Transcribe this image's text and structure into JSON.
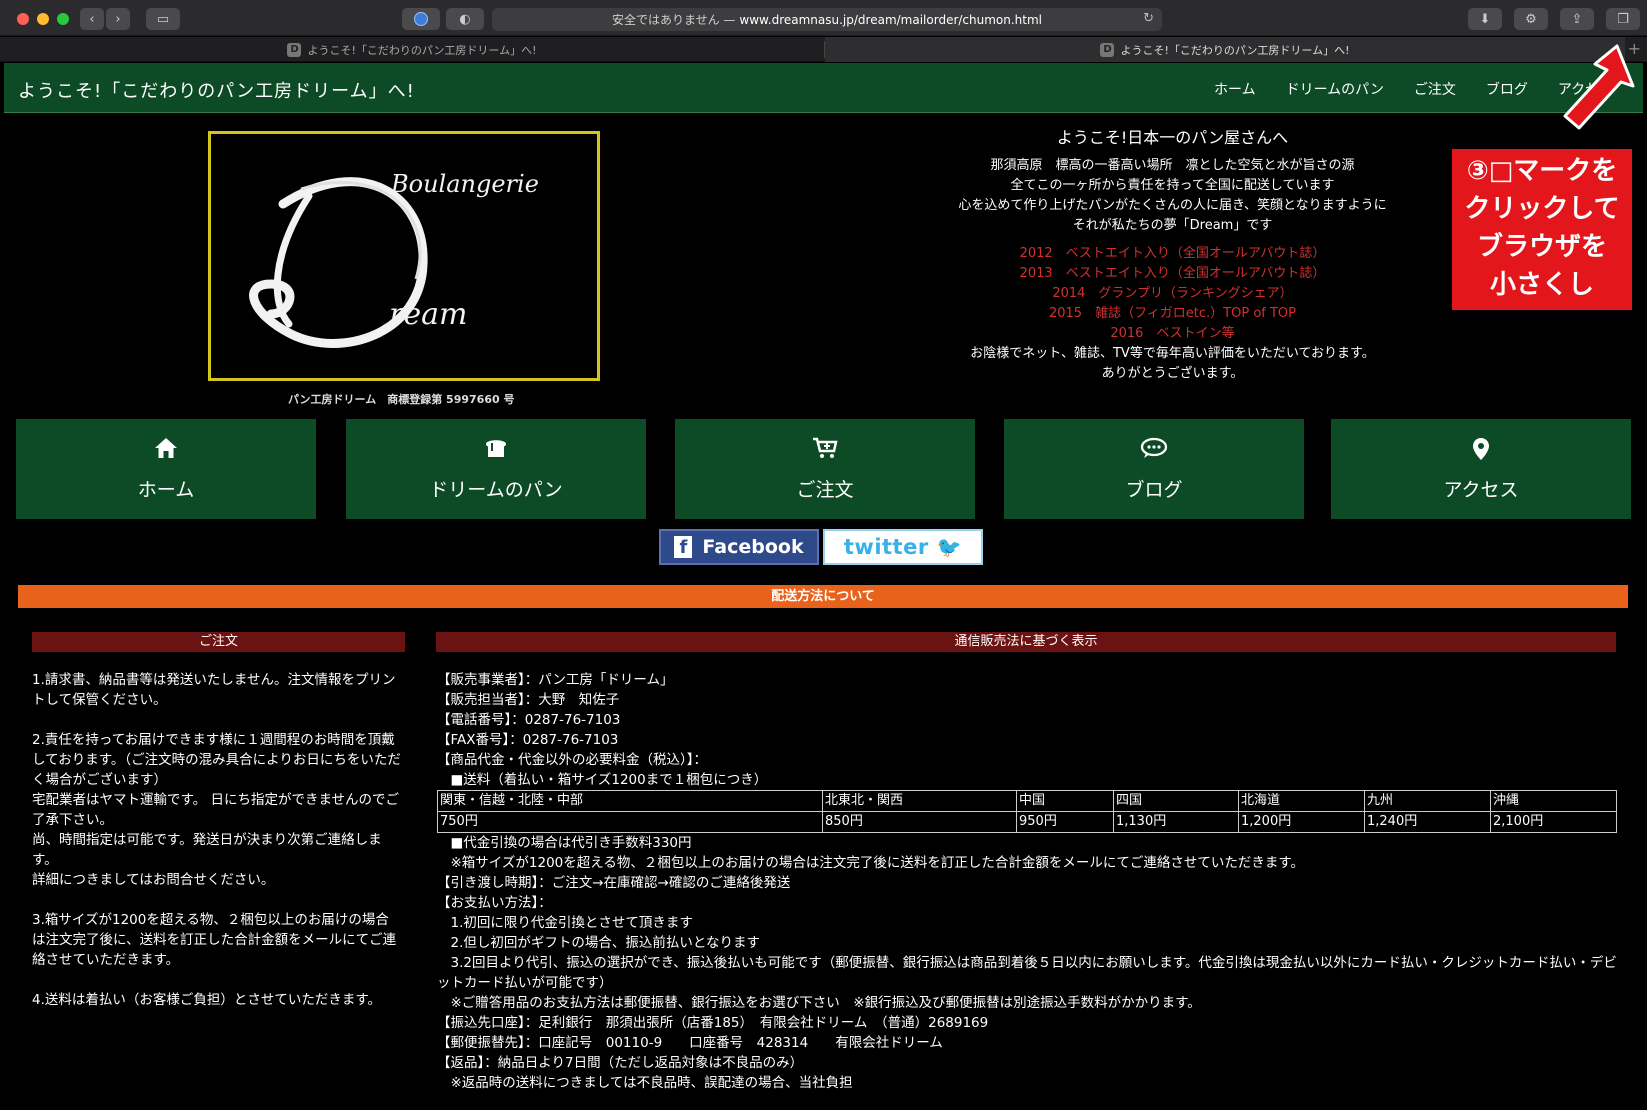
{
  "browser": {
    "url_prefix": "安全ではありません —",
    "url_host": "www.dreamnasu.jp/dream/mailorder/chumon.html",
    "tabs": [
      {
        "favicon": "D",
        "title": "ようこそ!「こだわりのパン工房ドリーム」へ!"
      },
      {
        "favicon": "D",
        "title": "ようこそ!「こだわりのパン工房ドリーム」へ!"
      }
    ]
  },
  "header": {
    "title": "ようこそ!「こだわりのパン工房ドリーム」へ!",
    "nav": [
      "ホーム",
      "ドリームのパン",
      "ご注文",
      "ブログ",
      "アクセス"
    ]
  },
  "logo": {
    "line1": "Boulangerie",
    "line2": "ream",
    "caption": "パン工房ドリーム　商標登録第 5997660 号"
  },
  "welcome": {
    "heading": "ようこそ!日本一のパン屋さんへ",
    "lines": [
      "那須高原　標高の一番高い場所　凛とした空気と水が旨さの源",
      "全てこの一ヶ所から責任を持って全国に配送しています",
      "心を込めて作り上げたパンがたくさんの人に届き、笑顔となりますように",
      "それが私たちの夢「Dream」です"
    ],
    "awards": [
      "2012　ベストエイト入り（全国オールアバウト誌）",
      "2013　ベストエイト入り（全国オールアバウト誌）",
      "2014　グランプリ（ランキングシェア）",
      "2015　雑誌（フィガロetc.）TOP of TOP",
      "2016　ベストイン等"
    ],
    "closing": [
      "お陰様でネット、雑誌、TV等で毎年高い評価をいただいております。",
      "ありがとうございます。"
    ]
  },
  "annotation": {
    "lines": [
      "③□マークを",
      "クリックして",
      "ブラウザを",
      "小さくし"
    ]
  },
  "tiles": [
    {
      "icon": "home-icon",
      "label": "ホーム"
    },
    {
      "icon": "bread-icon",
      "label": "ドリームのパン"
    },
    {
      "icon": "cart-icon",
      "label": "ご注文"
    },
    {
      "icon": "chat-icon",
      "label": "ブログ"
    },
    {
      "icon": "map-pin-icon",
      "label": "アクセス"
    }
  ],
  "social": {
    "facebook": "Facebook",
    "twitter": "twitter"
  },
  "shipping_bar": "配送方法について",
  "order": {
    "heading": "ご注文",
    "paragraphs": [
      "1.請求書、納品書等は発送いたしません。注文情報をプリントして保管ください。",
      "2.責任を持ってお届けできます様に１週間程のお時間を頂戴しております。（ご注文時の混み具合によりお日にちをいただく場合がございます）\n宅配業者はヤマト運輸です。 日にち指定ができませんのでご了承下さい。\n尚、時間指定は可能です。発送日が決まり次第ご連絡します。\n詳細につきましてはお問合せください。",
      "3.箱サイズが1200を超える物、２梱包以上のお届けの場合は注文完了後に、送料を訂正した合計金額をメールにてご連絡させていただきます。",
      "4.送料は着払い（お客様ご負担）とさせていただきます。"
    ]
  },
  "law": {
    "heading": "通信販売法に基づく表示",
    "lines_top": [
      "【販売事業者】：パン工房「ドリーム」",
      "【販売担当者】：大野　知佐子",
      "【電話番号】：0287-76-7103",
      "【FAX番号】：0287-76-7103",
      "【商品代金・代金以外の必要料金（税込）】：",
      "　■送料（着払い・箱サイズ1200まで１梱包につき）"
    ],
    "table": {
      "regions": [
        "関東・信越・北陸・中部",
        "北東北・関西",
        "中国",
        "四国",
        "北海道",
        "九州",
        "沖縄"
      ],
      "prices": [
        "750円",
        "850円",
        "950円",
        "1,130円",
        "1,200円",
        "1,240円",
        "2,100円"
      ]
    },
    "lines_bottom": [
      "　■代金引換の場合は代引き手数料330円",
      "　※箱サイズが1200を超える物、２梱包以上のお届けの場合は注文完了後に送料を訂正した合計金額をメールにてご連絡させていただきます。",
      "【引き渡し時期】：ご注文→在庫確認→確認のご連絡後発送",
      "【お支払い方法】：",
      "　1.初回に限り代金引換とさせて頂きます",
      "　2.但し初回がギフトの場合、振込前払いとなります",
      "　3.2回目より代引、振込の選択ができ、振込後払いも可能です（郵便振替、銀行振込は商品到着後５日以内にお願いします。代金引換は現金払い以外にカード払い・クレジットカード払い・デビットカード払いが可能です）",
      "　※ご贈答用品のお支払方法は郵便振替、銀行振込をお選び下さい　※銀行振込及び郵便振替は別途振込手数料がかかります。",
      "【振込先口座】：足利銀行　那須出張所（店番185）　有限会社ドリーム　（普通）2689169",
      "【郵便振替先】：口座記号　00110-9　　口座番号　428314　　有限会社ドリーム",
      "【返品】：納品日より7日間（ただし返品対象は不良品のみ）",
      "　※返品時の送料につきましては不良品時、誤配達の場合、当社負担"
    ]
  },
  "colors": {
    "header_green": "#0d4a26",
    "accent_orange": "#e8621c",
    "column_head": "#6b1212",
    "award_red": "#d43030",
    "annotation_red": "#e3161c",
    "logo_border": "#d4c51a"
  }
}
